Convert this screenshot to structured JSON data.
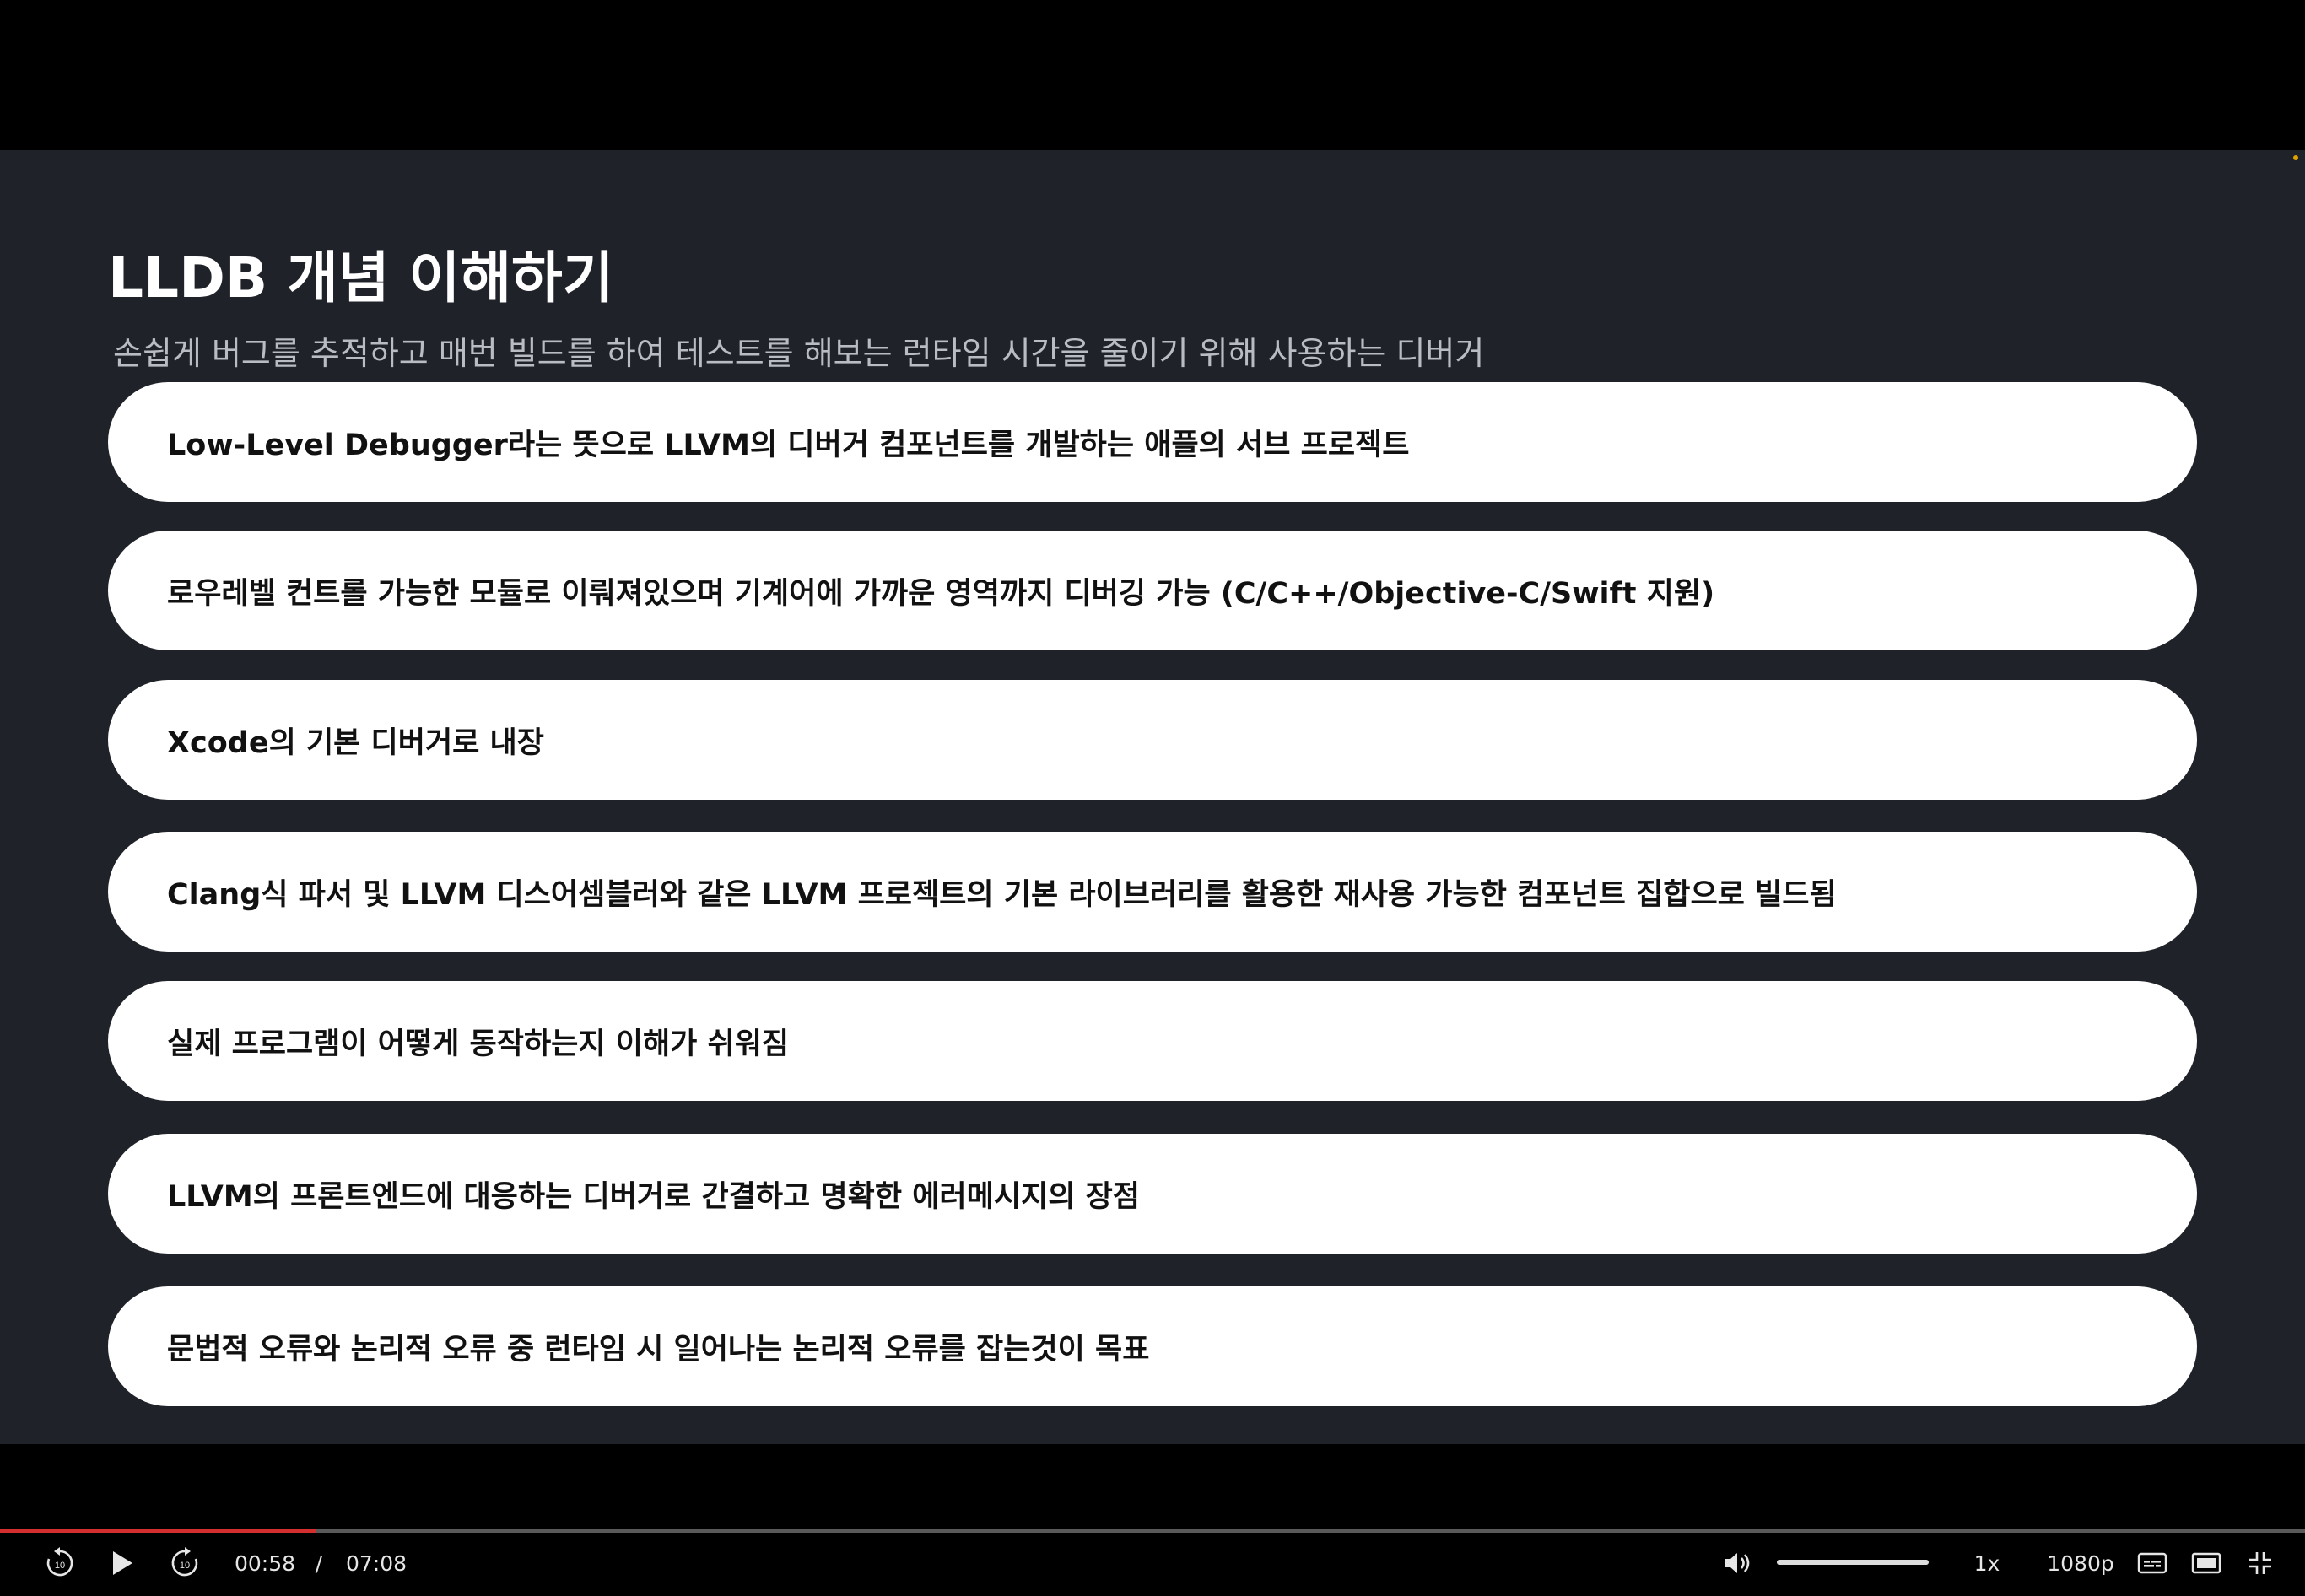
{
  "slide": {
    "title": "LLDB 개념 이해하기",
    "subtitle": "손쉽게 버그를 추적하고 매번 빌드를 하여 테스트를 해보는 런타임 시간을 줄이기 위해 사용하는 디버거",
    "items": [
      "Low-Level Debugger라는 뜻으로 LLVM의 디버거 컴포넌트를 개발하는 애플의 서브 프로젝트",
      "로우레벨 컨트롤 가능한 모듈로 이뤄져있으며 기계어에 가까운 영역까지 디버깅 가능 (C/C++/Objective-C/Swift 지원)",
      "Xcode의 기본 디버거로 내장",
      "Clang식 파서 및 LLVM 디스어셈블러와 같은 LLVM 프로젝트의 기본 라이브러리를 활용한 재사용 가능한 컴포넌트 집합으로 빌드됨",
      "실제 프로그램이 어떻게 동작하는지 이해가 쉬워짐",
      "LLVM의 프론트엔드에 대응하는 디버거로 간결하고 명확한 에러메시지의 장점",
      "문법적 오류와 논리적 오류 중 런타임 시 일어나는 논리적 오류를 잡는것이 목표"
    ]
  },
  "player": {
    "current_time": "00:58",
    "separator": "/",
    "duration": "07:08",
    "progress_fraction": 0.137,
    "volume_fraction": 1.0,
    "speed_label": "1x",
    "quality_label": "1080p",
    "skip_back_label": "10",
    "skip_forward_label": "10",
    "icons": {
      "skip_back": "rewind-10-icon",
      "play": "play-icon",
      "skip_forward": "forward-10-icon",
      "volume": "volume-icon",
      "captions": "captions-icon",
      "theater": "theater-mode-icon",
      "exit_fullscreen": "exit-fullscreen-icon"
    },
    "colors": {
      "progress": "#d32f2f",
      "slide_background": "#1f2329"
    }
  }
}
